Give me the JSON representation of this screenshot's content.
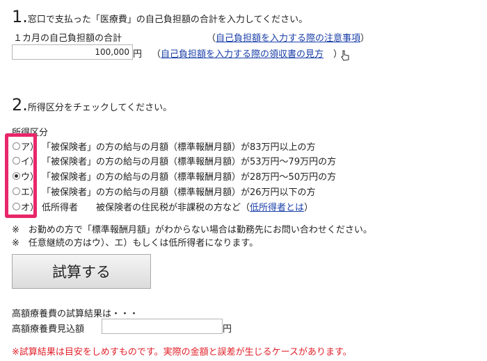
{
  "section1": {
    "num": "1.",
    "title": "窓口で支払った「医療費」の自己負担額の合計を入力してください。",
    "field_label": "１カ月の自己負担額の合計",
    "link1_open": "（",
    "link1": "自己負担額を入力する際の注意事項",
    "link1_close": "）",
    "amount_value": "100,000",
    "yen": "円",
    "link2_open": "（",
    "link2": "自己負担額を入力する際の領収書の見方",
    "link2_close": "）"
  },
  "section2": {
    "num": "2.",
    "title": "所得区分をチェックしてください。",
    "group_label": "所得区分",
    "options": [
      {
        "label": "ア）",
        "text": "「被保険者」の方の給与の月額（標準報酬月額）が83万円以上の方",
        "checked": false
      },
      {
        "label": "イ）",
        "text": "「被保険者」の方の給与の月額（標準報酬月額）が53万円～79万円の方",
        "checked": false
      },
      {
        "label": "ウ）",
        "text": "「被保険者」の方の給与の月額（標準報酬月額）が28万円～50万円の方",
        "checked": true
      },
      {
        "label": "エ）",
        "text": "「被保険者」の方の給与の月額（標準報酬月額）が26万円以下の方",
        "checked": false
      },
      {
        "label": "オ）",
        "text": "低所得者　　被保険者の住民税が非課税の方など（",
        "link": "低所得者とは",
        "link_close": "）",
        "checked": false
      }
    ],
    "note1": "※　お勤めの方で「標準報酬月額」がわからない場合は勤務先にお問い合わせください。",
    "note2": "※　任意継続の方はウ）、エ）もしくは低所得者になります。"
  },
  "calc_button": "試算する",
  "result": {
    "heading": "高額療養費の試算結果は・・・",
    "label": "高額療養費見込額",
    "value": "",
    "yen": "円",
    "disclaimer": "※試算結果は目安をしめすものです。実際の金額と誤差が生じるケースがあります。"
  },
  "colors": {
    "link": "#1a3fa8",
    "highlight": "#e8266a",
    "warning": "#e0202a"
  }
}
